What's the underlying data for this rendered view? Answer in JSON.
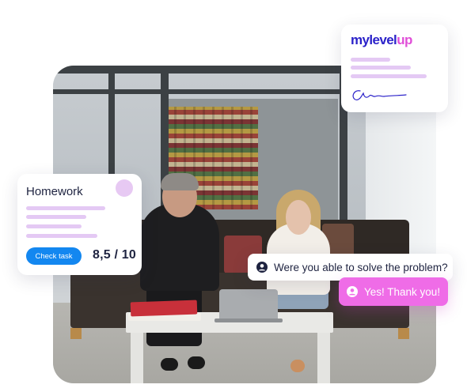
{
  "brand": {
    "part1": "mylevel",
    "part2": "up"
  },
  "homework_card": {
    "title": "Homework",
    "check_label": "Check task",
    "score": "8,5 / 10"
  },
  "chat": {
    "question": "Were you able to solve the problem?",
    "answer": "Yes! Thank you!"
  },
  "colors": {
    "brand_blue": "#2b22c9",
    "brand_pink": "#e04fd8",
    "accent_button": "#1387f0",
    "answer_bubble": "#ef6ce7",
    "placeholder_bar": "#e4c9f4"
  },
  "icons": {
    "question_avatar": "user-circle-icon",
    "answer_avatar": "user-circle-icon",
    "signature": "signature-icon"
  }
}
